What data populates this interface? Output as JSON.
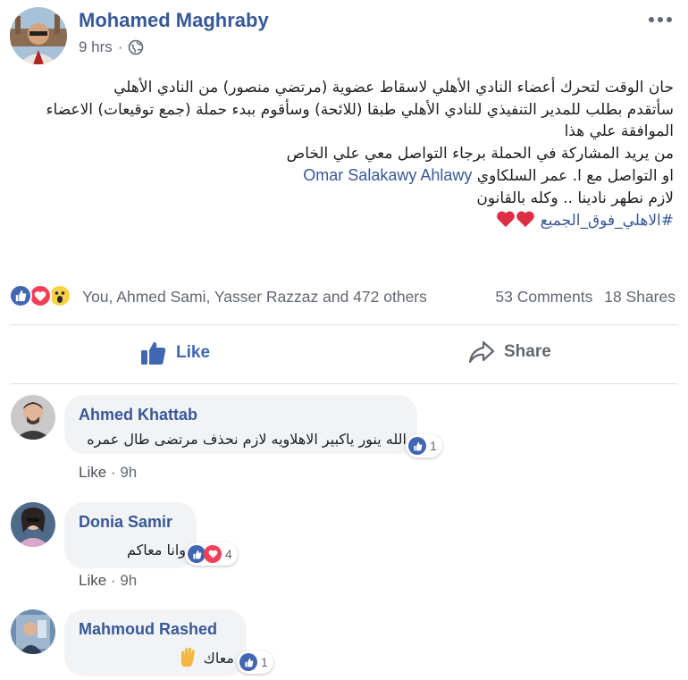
{
  "post": {
    "author": "Mohamed Maghraby",
    "time": "9 hrs",
    "dot": "·",
    "lines": [
      "حان الوقت لتحرك أعضاء النادي الأهلي لاسقاط عضوية (مرتضي منصور) من النادي الأهلي",
      "سأتقدم بطلب للمدير التنفيذي للنادي الأهلي طبقا (للائحة) وسأقوم ببدء حملة (جمع توقيعات) الاعضاء",
      "الموافقة علي هذا",
      "من يريد المشاركة في الحملة برجاء التواصل معي علي الخاص",
      "لازم نطهر نادينا .. وكله بالقانون"
    ],
    "contact_prefix": "او التواصل مع ا. عمر السلكاوي",
    "contact_link": "Omar Salakawy Ahlawy",
    "hashtag": "#الاهلي_فوق_الجميع"
  },
  "reactions": {
    "names": "You, Ahmed Sami, Yasser Razzaz and 472 others",
    "comments": "53 Comments",
    "shares": "18 Shares"
  },
  "actions": {
    "like": "Like",
    "share": "Share"
  },
  "comments": [
    {
      "name": "Ahmed Khattab",
      "text": "الله ينور ياكبير الاهلاويه لازم نحذف مرتضى طال عمره",
      "count": "1",
      "like": "Like",
      "dot": "·",
      "time": "9h"
    },
    {
      "name": "Donia Samir",
      "text": "وانا معاكم",
      "count": "4",
      "like": "Like",
      "dot": "·",
      "time": "9h"
    },
    {
      "name": "Mahmoud Rashed",
      "text": "معاك",
      "count": "1"
    }
  ],
  "colors": {
    "link": "#385898",
    "like_blue": "#4267b2",
    "love_red": "#f33e58",
    "wow_yellow": "#fcd144"
  }
}
